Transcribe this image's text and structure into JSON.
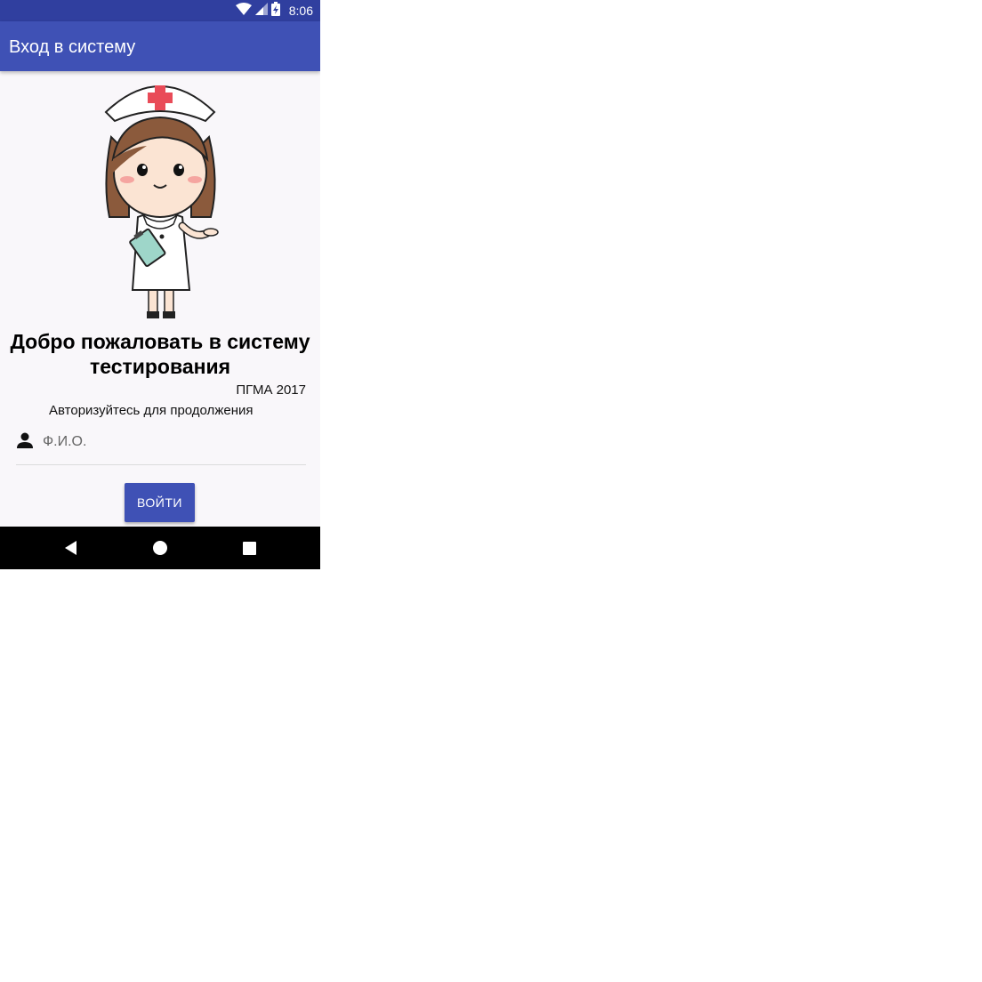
{
  "status_bar": {
    "time": "8:06",
    "icons": [
      "wifi-icon",
      "signal-icon",
      "battery-charging-icon"
    ]
  },
  "app_bar": {
    "title": "Вход в систему"
  },
  "main": {
    "illustration": "nurse-illustration",
    "welcome_title": "Добро пожаловать в системy тестирования",
    "org_label": "ПГМА 2017",
    "subtitle": "Авторизуйтесь для продолжения",
    "name_field": {
      "placeholder": "Ф.И.О.",
      "value": "",
      "icon": "person-icon"
    },
    "login_label": "ВОЙТИ"
  },
  "nav_bar": {
    "icons": [
      "back-icon",
      "home-icon",
      "recents-icon"
    ]
  },
  "colors": {
    "status_bar": "#303f9f",
    "primary": "#3f51b5",
    "background": "#f9f7fa",
    "nav_bar": "#000000"
  }
}
